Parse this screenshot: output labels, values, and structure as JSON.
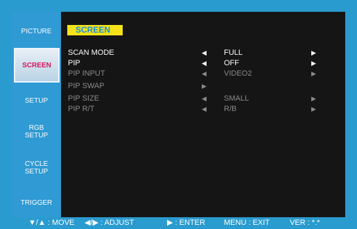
{
  "sidebar": {
    "items": [
      {
        "label": "PICTURE"
      },
      {
        "label": "SCREEN"
      },
      {
        "label": "SETUP"
      },
      {
        "label": "RGB\nSETUP"
      },
      {
        "label": "CYCLE\nSETUP"
      },
      {
        "label": "TRIGGER"
      }
    ],
    "active_index": 1
  },
  "main": {
    "title": "SCREEN",
    "rows": [
      {
        "label": "SCAN MODE",
        "left_arrow": "◀",
        "value": "FULL",
        "right_arrow": "▶",
        "enabled": true
      },
      {
        "label": "PIP",
        "left_arrow": "◀",
        "value": "OFF",
        "right_arrow": "▶",
        "enabled": true
      },
      {
        "label": "PIP INPUT",
        "left_arrow": "◀",
        "value": "VIDEO2",
        "right_arrow": "▶",
        "enabled": false
      },
      {
        "label": "PIP SWAP",
        "left_arrow": "▶",
        "value": "",
        "right_arrow": "",
        "enabled": false
      },
      {
        "label": "PIP SIZE",
        "left_arrow": "◀",
        "value": "SMALL",
        "right_arrow": "▶",
        "enabled": false
      },
      {
        "label": "PIP R/T",
        "left_arrow": "◀",
        "value": "R/B",
        "right_arrow": "▶",
        "enabled": false
      }
    ]
  },
  "footer": {
    "move": "▼/▲ : MOVE",
    "adjust": "◀/▶ : ADJUST",
    "enter": "▶ : ENTER",
    "exit": "MENU : EXIT",
    "version": "VER : *.*"
  },
  "colors": {
    "background": "#2a9bcf",
    "title_bg": "#f4e31a",
    "title_text": "#1a8fd4",
    "active_text": "#d4145a"
  }
}
